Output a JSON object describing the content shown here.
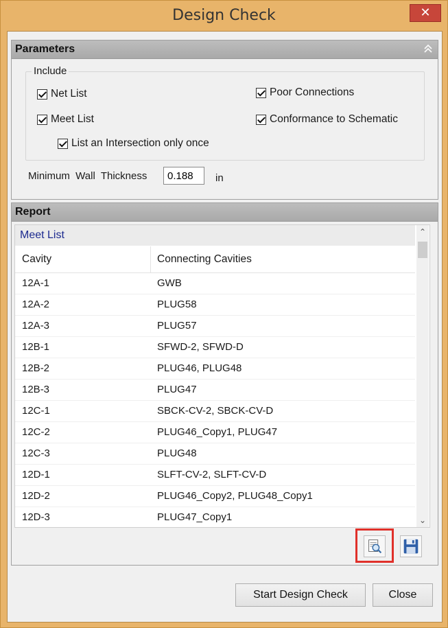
{
  "window": {
    "title": "Design Check",
    "close_glyph": "✕"
  },
  "parameters": {
    "header": "Parameters",
    "collapse_icon": "double-chevron-up-icon",
    "include": {
      "legend": "Include",
      "net_list": {
        "label": "Net List",
        "checked": true
      },
      "meet_list": {
        "label": "Meet List",
        "checked": true
      },
      "intersection_once": {
        "label": "List an Intersection only once",
        "checked": true
      },
      "poor_connections": {
        "label": "Poor Connections",
        "checked": true
      },
      "conformance": {
        "label": "Conformance to Schematic",
        "checked": true
      }
    },
    "min_wall": {
      "label": "Minimum  Wall  Thickness",
      "value": "0.188",
      "unit": "in"
    }
  },
  "report": {
    "header": "Report",
    "section_title": "Meet List",
    "columns": [
      "Cavity",
      "Connecting Cavities"
    ],
    "rows": [
      [
        "12A-1",
        "GWB"
      ],
      [
        "12A-2",
        "PLUG58"
      ],
      [
        "12A-3",
        "PLUG57"
      ],
      [
        "12B-1",
        "SFWD-2, SFWD-D"
      ],
      [
        "12B-2",
        "PLUG46, PLUG48"
      ],
      [
        "12B-3",
        "PLUG47"
      ],
      [
        "12C-1",
        "SBCK-CV-2, SBCK-CV-D"
      ],
      [
        "12C-2",
        "PLUG46_Copy1, PLUG47"
      ],
      [
        "12C-3",
        "PLUG48"
      ],
      [
        "12D-1",
        "SLFT-CV-2, SLFT-CV-D"
      ],
      [
        "12D-2",
        "PLUG46_Copy2, PLUG48_Copy1"
      ],
      [
        "12D-3",
        "PLUG47_Copy1"
      ]
    ],
    "icons": {
      "preview": "print-preview-icon",
      "save": "save-icon"
    }
  },
  "buttons": {
    "start": "Start Design Check",
    "close": "Close"
  },
  "colors": {
    "title_bar": "#e8b46a",
    "close_button": "#c7463a",
    "highlight": "#e0302a",
    "section_title_text": "#1c2a8f"
  }
}
